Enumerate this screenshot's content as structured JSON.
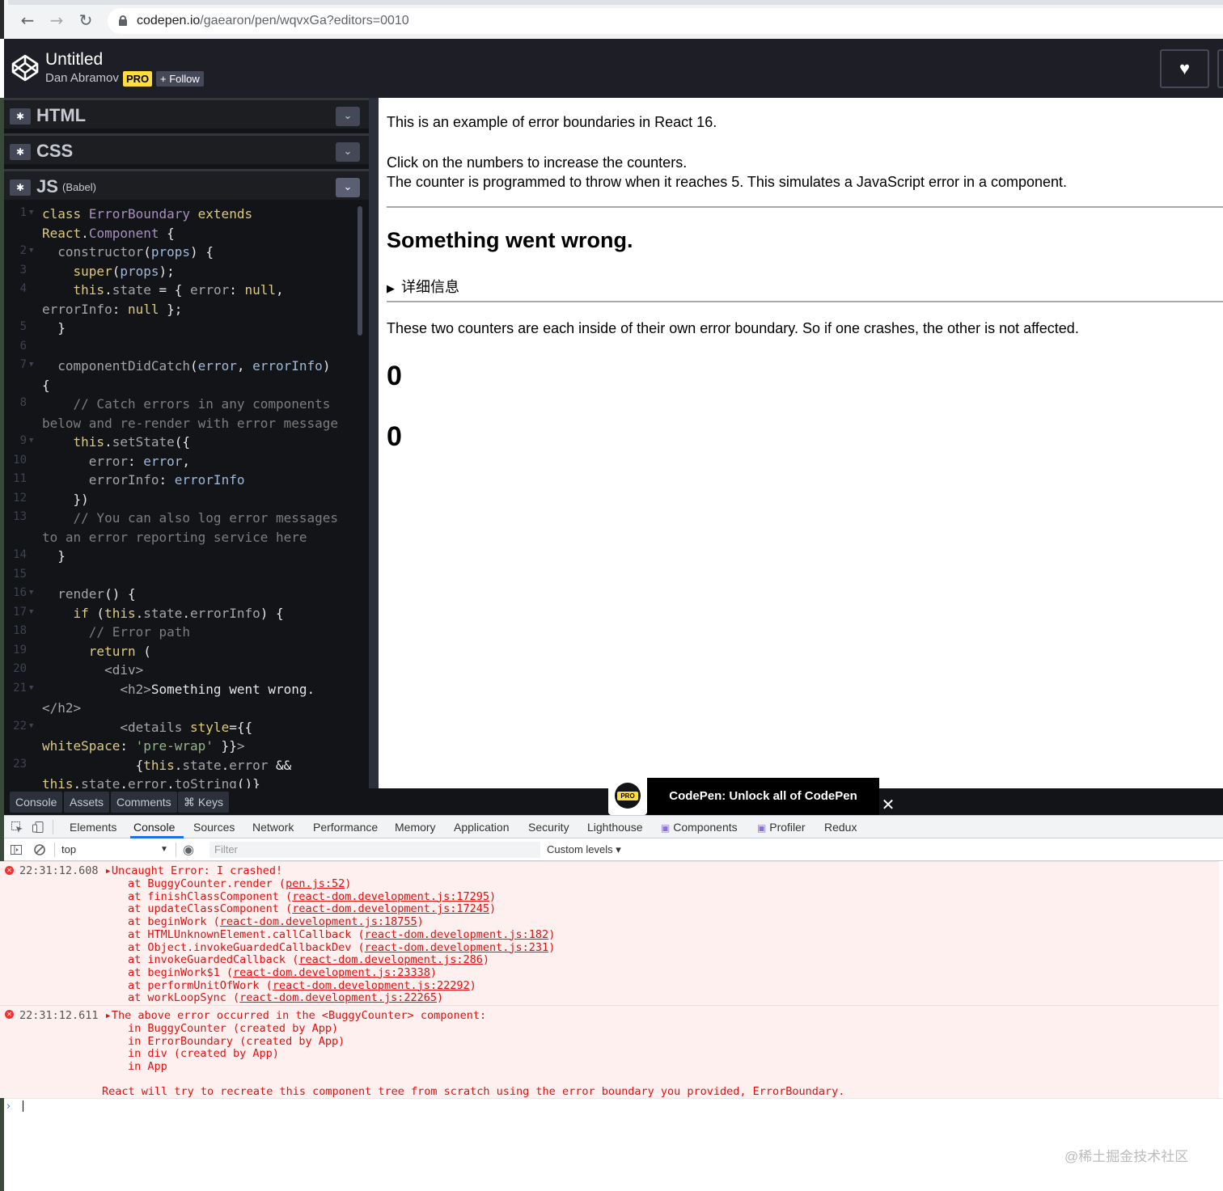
{
  "browser": {
    "url_host": "codepen.io",
    "url_path": "/gaearon/pen/wqvxGa?editors=0010"
  },
  "header": {
    "title": "Untitled",
    "author": "Dan Abramov",
    "pro_label": "PRO",
    "follow_label": "+ Follow"
  },
  "editors": {
    "html_label": "HTML",
    "css_label": "CSS",
    "js_label": "JS",
    "js_sub": "(Babel)"
  },
  "code_lines": [
    {
      "n": "1",
      "fold": true,
      "parts": [
        [
          "kw",
          "class "
        ],
        [
          "cls",
          "ErrorBoundary "
        ],
        [
          "kw",
          "extends"
        ]
      ]
    },
    {
      "n": "",
      "fold": false,
      "parts": [
        [
          "kw",
          "React"
        ],
        [
          "plain",
          "."
        ],
        [
          "cls",
          "Component"
        ],
        [
          "plain",
          " {"
        ]
      ]
    },
    {
      "n": "2",
      "fold": true,
      "parts": [
        [
          "plain",
          "  "
        ],
        [
          "mth",
          "constructor"
        ],
        [
          "plain",
          "("
        ],
        [
          "prm",
          "props"
        ],
        [
          "plain",
          ") {"
        ]
      ]
    },
    {
      "n": "3",
      "fold": false,
      "parts": [
        [
          "plain",
          "    "
        ],
        [
          "kw",
          "super"
        ],
        [
          "plain",
          "("
        ],
        [
          "prm",
          "props"
        ],
        [
          "plain",
          ");"
        ]
      ]
    },
    {
      "n": "4",
      "fold": false,
      "parts": [
        [
          "plain",
          "    "
        ],
        [
          "kw",
          "this"
        ],
        [
          "plain",
          "."
        ],
        [
          "mth",
          "state"
        ],
        [
          "plain",
          " = { "
        ],
        [
          "mth",
          "error"
        ],
        [
          "plain",
          ": "
        ],
        [
          "kw",
          "null"
        ],
        [
          "plain",
          ","
        ]
      ]
    },
    {
      "n": "",
      "fold": false,
      "parts": [
        [
          "mth",
          "errorInfo"
        ],
        [
          "plain",
          ": "
        ],
        [
          "kw",
          "null"
        ],
        [
          "plain",
          " };"
        ]
      ]
    },
    {
      "n": "5",
      "fold": false,
      "parts": [
        [
          "plain",
          "  }"
        ]
      ]
    },
    {
      "n": "6",
      "fold": false,
      "parts": [
        [
          "plain",
          ""
        ]
      ]
    },
    {
      "n": "7",
      "fold": true,
      "parts": [
        [
          "plain",
          "  "
        ],
        [
          "mth",
          "componentDidCatch"
        ],
        [
          "plain",
          "("
        ],
        [
          "prm",
          "error"
        ],
        [
          "plain",
          ", "
        ],
        [
          "prm",
          "errorInfo"
        ],
        [
          "plain",
          ")"
        ]
      ]
    },
    {
      "n": "",
      "fold": false,
      "parts": [
        [
          "plain",
          "{"
        ]
      ]
    },
    {
      "n": "8",
      "fold": false,
      "parts": [
        [
          "cmt",
          "    // Catch errors in any components"
        ]
      ]
    },
    {
      "n": "",
      "fold": false,
      "parts": [
        [
          "cmt",
          "below and re-render with error message"
        ]
      ]
    },
    {
      "n": "9",
      "fold": true,
      "parts": [
        [
          "plain",
          "    "
        ],
        [
          "kw",
          "this"
        ],
        [
          "plain",
          "."
        ],
        [
          "mth",
          "setState"
        ],
        [
          "plain",
          "({"
        ]
      ]
    },
    {
      "n": "10",
      "fold": false,
      "parts": [
        [
          "plain",
          "      "
        ],
        [
          "mth",
          "error"
        ],
        [
          "plain",
          ": "
        ],
        [
          "prm",
          "error"
        ],
        [
          "plain",
          ","
        ]
      ]
    },
    {
      "n": "11",
      "fold": false,
      "parts": [
        [
          "plain",
          "      "
        ],
        [
          "mth",
          "errorInfo"
        ],
        [
          "plain",
          ": "
        ],
        [
          "prm",
          "errorInfo"
        ]
      ]
    },
    {
      "n": "12",
      "fold": false,
      "parts": [
        [
          "plain",
          "    })"
        ]
      ]
    },
    {
      "n": "13",
      "fold": false,
      "parts": [
        [
          "cmt",
          "    // You can also log error messages"
        ]
      ]
    },
    {
      "n": "",
      "fold": false,
      "parts": [
        [
          "cmt",
          "to an error reporting service here"
        ]
      ]
    },
    {
      "n": "14",
      "fold": false,
      "parts": [
        [
          "plain",
          "  }"
        ]
      ]
    },
    {
      "n": "15",
      "fold": false,
      "parts": [
        [
          "plain",
          ""
        ]
      ]
    },
    {
      "n": "16",
      "fold": true,
      "parts": [
        [
          "plain",
          "  "
        ],
        [
          "mth",
          "render"
        ],
        [
          "plain",
          "() {"
        ]
      ]
    },
    {
      "n": "17",
      "fold": true,
      "parts": [
        [
          "plain",
          "    "
        ],
        [
          "kw",
          "if"
        ],
        [
          "plain",
          " ("
        ],
        [
          "kw",
          "this"
        ],
        [
          "plain",
          "."
        ],
        [
          "mth",
          "state"
        ],
        [
          "plain",
          "."
        ],
        [
          "mth",
          "errorInfo"
        ],
        [
          "plain",
          ") {"
        ]
      ]
    },
    {
      "n": "18",
      "fold": false,
      "parts": [
        [
          "cmt",
          "      // Error path"
        ]
      ]
    },
    {
      "n": "19",
      "fold": false,
      "parts": [
        [
          "plain",
          "      "
        ],
        [
          "kw",
          "return"
        ],
        [
          "plain",
          " ("
        ]
      ]
    },
    {
      "n": "20",
      "fold": false,
      "parts": [
        [
          "plain",
          "        "
        ],
        [
          "tag",
          "<div>"
        ]
      ]
    },
    {
      "n": "21",
      "fold": true,
      "parts": [
        [
          "plain",
          "          "
        ],
        [
          "tag",
          "<h2>"
        ],
        [
          "plain",
          "Something went wrong."
        ]
      ]
    },
    {
      "n": "",
      "fold": false,
      "parts": [
        [
          "tag",
          "</h2>"
        ]
      ]
    },
    {
      "n": "22",
      "fold": true,
      "parts": [
        [
          "plain",
          "          "
        ],
        [
          "tag",
          "<details "
        ],
        [
          "kw",
          "style"
        ],
        [
          "plain",
          "={{"
        ]
      ]
    },
    {
      "n": "",
      "fold": false,
      "parts": [
        [
          "kw",
          "whiteSpace"
        ],
        [
          "plain",
          ": "
        ],
        [
          "str",
          "'pre-wrap'"
        ],
        [
          "plain",
          " }}"
        ],
        [
          "tag",
          ">"
        ]
      ]
    },
    {
      "n": "23",
      "fold": false,
      "parts": [
        [
          "plain",
          "            {"
        ],
        [
          "kw",
          "this"
        ],
        [
          "plain",
          "."
        ],
        [
          "mth",
          "state"
        ],
        [
          "plain",
          "."
        ],
        [
          "mth",
          "error"
        ],
        [
          "plain",
          " &&"
        ]
      ]
    },
    {
      "n": "",
      "fold": false,
      "parts": [
        [
          "kw",
          "this"
        ],
        [
          "plain",
          "."
        ],
        [
          "mth",
          "state"
        ],
        [
          "plain",
          "."
        ],
        [
          "mth",
          "error"
        ],
        [
          "plain",
          "."
        ],
        [
          "mth",
          "toString"
        ],
        [
          "plain",
          "()}"
        ]
      ]
    }
  ],
  "preview": {
    "intro": "This is an example of error boundaries in React 16.",
    "click": "Click on the numbers to increase the counters.",
    "throw_note": "The counter is programmed to throw when it reaches 5. This simulates a JavaScript error in a component.",
    "error_heading": "Something went wrong.",
    "details_label": "详细信息",
    "two_counters": "These two counters are each inside of their own error boundary. So if one crashes, the other is not affected.",
    "counter1": "0",
    "counter2": "0"
  },
  "promo": {
    "pro_label": "PRO",
    "text": "CodePen: Unlock all of CodePen"
  },
  "bottom_bar": [
    "Console",
    "Assets",
    "Comments",
    "⌘ Keys"
  ],
  "devtools": {
    "tabs": [
      "Elements",
      "Console",
      "Sources",
      "Network",
      "Performance",
      "Memory",
      "Application",
      "Security",
      "Lighthouse",
      "Components",
      "Profiler",
      "Redux"
    ],
    "context": "top",
    "filter_placeholder": "Filter",
    "levels": "Custom levels ▾",
    "error1": {
      "time": "22:31:12.608",
      "message": "Uncaught Error: I crashed!",
      "stack": [
        [
          "at BuggyCounter.render (",
          "pen.js:52",
          ")"
        ],
        [
          "at finishClassComponent (",
          "react-dom.development.js:17295",
          ")"
        ],
        [
          "at updateClassComponent (",
          "react-dom.development.js:17245",
          ")"
        ],
        [
          "at beginWork (",
          "react-dom.development.js:18755",
          ")"
        ],
        [
          "at HTMLUnknownElement.callCallback (",
          "react-dom.development.js:182",
          ")"
        ],
        [
          "at Object.invokeGuardedCallbackDev (",
          "react-dom.development.js:231",
          ")"
        ],
        [
          "at invokeGuardedCallback (",
          "react-dom.development.js:286",
          ")"
        ],
        [
          "at beginWork$1 (",
          "react-dom.development.js:23338",
          ")"
        ],
        [
          "at performUnitOfWork (",
          "react-dom.development.js:22292",
          ")"
        ],
        [
          "at workLoopSync (",
          "react-dom.development.js:22265",
          ")"
        ]
      ]
    },
    "error2": {
      "time": "22:31:12.611",
      "message": "The above error occurred in the <BuggyCounter> component:",
      "lines": [
        "in BuggyCounter (created by App)",
        "in ErrorBoundary (created by App)",
        "in div (created by App)",
        "in App"
      ],
      "footer": "React will try to recreate this component tree from scratch using the error boundary you provided, ErrorBoundary."
    }
  },
  "watermark": "@稀土掘金技术社区"
}
